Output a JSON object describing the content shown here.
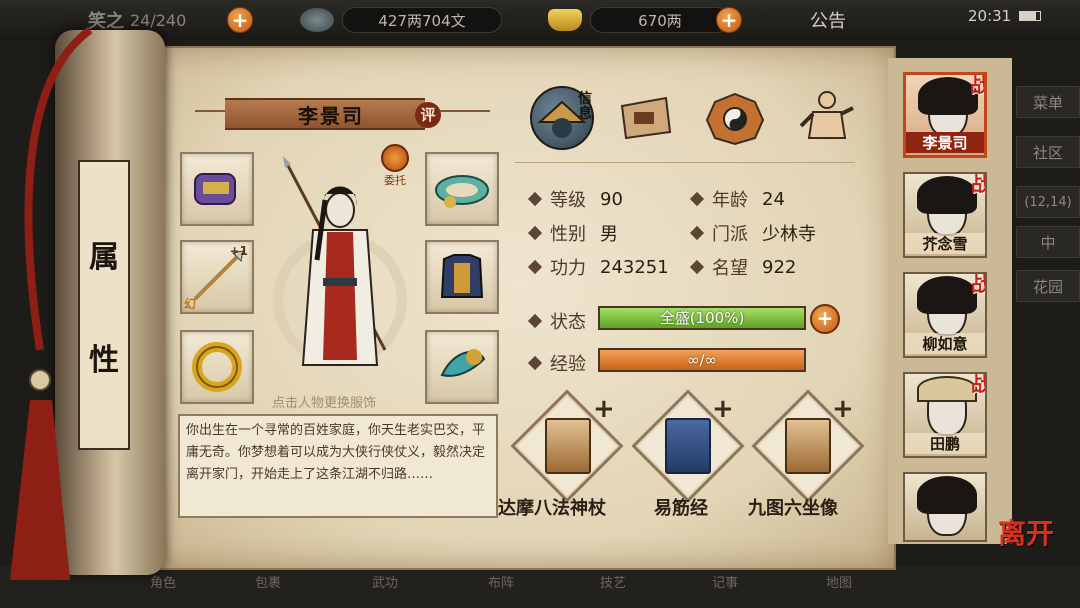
{
  "topbar": {
    "capacity_label": "笑之",
    "capacity_value": "24/240",
    "copper_value": "427两704文",
    "silver_value": "670两",
    "notice_label": "公告",
    "clock": "20:31"
  },
  "side_menu": {
    "menu_label": "菜单",
    "community_label": "社区",
    "coords": "(12,14)",
    "middle_label": "中",
    "garden_label": "花园"
  },
  "scroll_tab": {
    "char1": "属",
    "char2": "性"
  },
  "character": {
    "name": "李景司",
    "rate_label": "评",
    "entrust_label": "委托",
    "change_tip": "点击人物更换服饰",
    "bio": "你出生在一个寻常的百姓家庭，你天生老实巴交，平庸无奇。你梦想着可以成为大侠行侠仗义，毅然决定离开家门，开始走上了这条江湖不归路……"
  },
  "equipment": {
    "weapon_level": "+1",
    "weapon_tag": "幻"
  },
  "tabs": {
    "info_label": "信息"
  },
  "stats": {
    "level_label": "等级",
    "level_value": "90",
    "age_label": "年龄",
    "age_value": "24",
    "gender_label": "性别",
    "gender_value": "男",
    "sect_label": "门派",
    "sect_value": "少林寺",
    "power_label": "功力",
    "power_value": "243251",
    "fame_label": "名望",
    "fame_value": "922",
    "status_label": "状态",
    "status_value": "全盛(100%)",
    "exp_label": "经验",
    "exp_value": "∞/∞"
  },
  "skills": [
    {
      "name": "达摩八法神杖",
      "plus": "+"
    },
    {
      "name": "易筋经",
      "plus": "+"
    },
    {
      "name": "九图六坐像",
      "plus": "+"
    }
  ],
  "roster": [
    {
      "name": "李景司",
      "badge": "战",
      "active": true
    },
    {
      "name": "芥念雪",
      "badge": "战"
    },
    {
      "name": "柳如意",
      "badge": "战"
    },
    {
      "name": "田鹏",
      "badge": "战"
    },
    {
      "name": "",
      "badge": ""
    }
  ],
  "leave_label": "离开",
  "bottom_nav": [
    "角色",
    "包裹",
    "武功",
    "布阵",
    "技艺",
    "记事",
    "地图"
  ],
  "colors": {
    "accent_red": "#c8231b",
    "hp_green": "#6db52e",
    "exp_orange": "#d8731c",
    "paper": "#e6d9bc"
  }
}
